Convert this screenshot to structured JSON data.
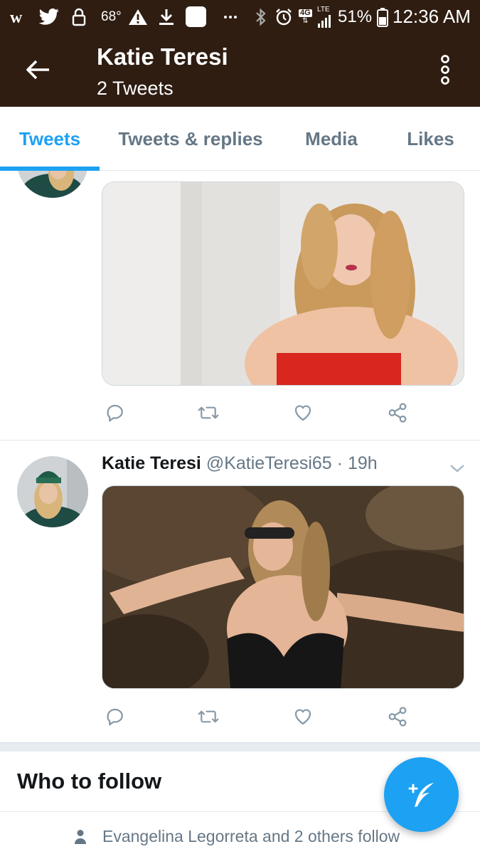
{
  "status_bar": {
    "temperature": "68°",
    "network": "4G",
    "lte": "LTE",
    "battery_percent": "51%",
    "time": "12:36 AM",
    "icons": [
      "wish-icon",
      "twitter-icon",
      "lock-icon",
      "warning-icon",
      "download-icon",
      "app-icon",
      "more-dots-icon",
      "bluetooth-icon",
      "alarm-icon",
      "signal-icon",
      "battery-icon"
    ]
  },
  "header": {
    "title": "Katie Teresi",
    "subtitle": "2 Tweets",
    "background": "#2f1d12"
  },
  "tabs": [
    {
      "label": "Tweets",
      "active": true
    },
    {
      "label": "Tweets & replies",
      "active": false
    },
    {
      "label": "Media",
      "active": false
    },
    {
      "label": "Likes",
      "active": false
    }
  ],
  "tweets": [
    {
      "name": "",
      "handle": "",
      "time": "",
      "media": "photo-red-top",
      "actions": [
        "reply-icon",
        "retweet-icon",
        "like-icon",
        "share-icon"
      ]
    },
    {
      "name": "Katie Teresi",
      "handle": "@KatieTeresi65",
      "separator": "·",
      "time": "19h",
      "media": "photo-beach-sunglasses",
      "actions": [
        "reply-icon",
        "retweet-icon",
        "like-icon",
        "share-icon"
      ]
    }
  ],
  "who_to_follow": {
    "title": "Who to follow",
    "social_context": "Evangelina Legorreta and 2 others follow"
  },
  "colors": {
    "accent": "#1da1f2",
    "secondary_text": "#657786",
    "icon_gray": "#8899a6"
  }
}
